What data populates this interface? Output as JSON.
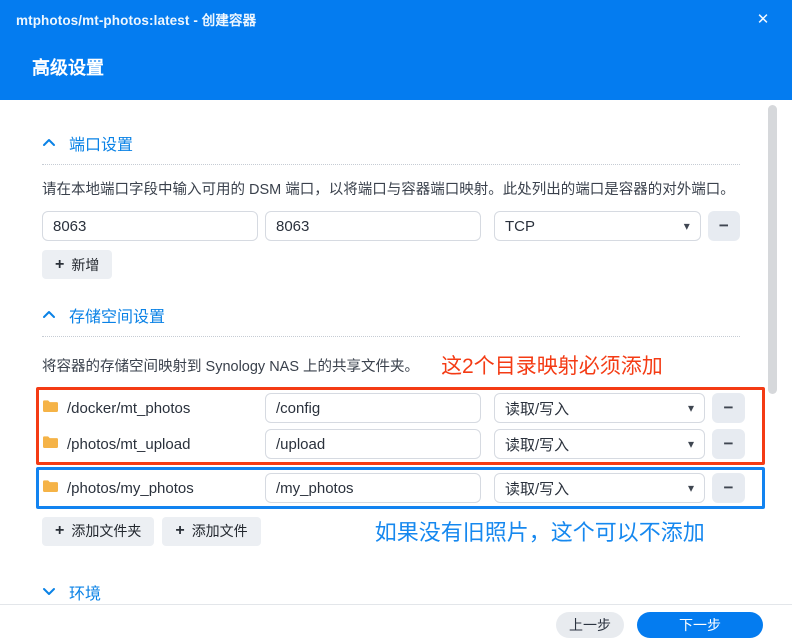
{
  "colors": {
    "accent_blue": "#047cf0",
    "section_title_blue": "#0a82e6",
    "annotation_red": "#f43b14",
    "annotation_blue": "#1688ef"
  },
  "icons": {
    "close": "✕",
    "plus": "+",
    "minus": "−",
    "caret_down": "▾"
  },
  "titlebar": {
    "title": "mtphotos/mt-photos:latest - 创建容器"
  },
  "header": {
    "title": "高级设置"
  },
  "port_section": {
    "title": "端口设置",
    "description": "请在本地端口字段中输入可用的 DSM 端口，以将端口与容器端口映射。此处列出的端口是容器的对外端口。",
    "rows": [
      {
        "local_port": "8063",
        "container_port": "8063",
        "protocol": "TCP"
      }
    ],
    "add_button": "新增"
  },
  "storage_section": {
    "title": "存储空间设置",
    "description": "将容器的存储空间映射到 Synology NAS 上的共享文件夹。",
    "required_note": "这2个目录映射必须添加",
    "optional_note": "如果没有旧照片，这个可以不添加",
    "rows": [
      {
        "folder": "/docker/mt_photos",
        "mount_path": "/config",
        "permission": "读取/写入"
      },
      {
        "folder": "/photos/mt_upload",
        "mount_path": "/upload",
        "permission": "读取/写入"
      },
      {
        "folder": "/photos/my_photos",
        "mount_path": "/my_photos",
        "permission": "读取/写入"
      }
    ],
    "add_folder_button": "添加文件夹",
    "add_file_button": "添加文件"
  },
  "env_section": {
    "title": "环境"
  },
  "footer": {
    "back_button": "上一步",
    "next_button": "下一步"
  }
}
